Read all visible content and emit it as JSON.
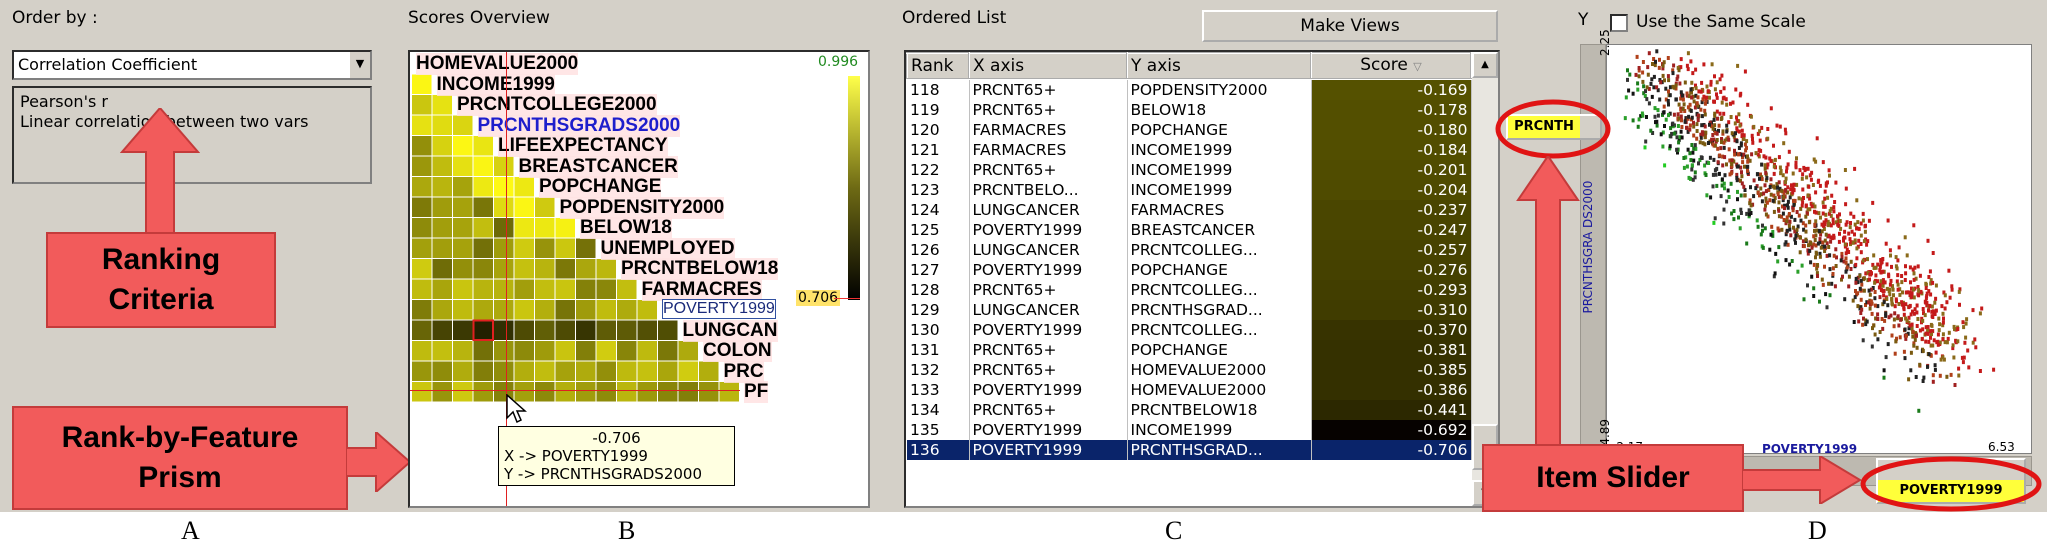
{
  "order_by": {
    "title": "Order by :",
    "criterion": "Correlation Coefficient",
    "description_line1": "Pearson's r",
    "description_line2": "Linear correlation between two vars"
  },
  "scores_overview": {
    "title": "Scores Overview",
    "max_label": "0.996",
    "marker_label": "0.706",
    "variables": [
      "HOMEVALUE2000",
      "INCOME1999",
      "PRCNTCOLLEGE2000",
      "PRCNTHSGRADS2000",
      "LIFEEXPECTANCY",
      "BREASTCANCER",
      "POPCHANGE",
      "POPDENSITY2000",
      "BELOW18",
      "UNEMPLOYED",
      "PRCNTBELOW18",
      "FARMACRES",
      "POVERTY1999",
      "LUNGCAN",
      "COLON",
      "PRC",
      "PF"
    ],
    "highlighted_variable": "PRCNTHSGRADS2000",
    "tooltip": {
      "value": "-0.706",
      "x": "X -> POVERTY1999",
      "y": "Y -> PRCNTHSGRADS2000"
    },
    "color_low": "#000000",
    "color_high": "#ffff4a",
    "highlight_color": "#1e1ecc"
  },
  "ordered_list": {
    "title": "Ordered List",
    "make_views": "Make Views",
    "columns": [
      "Rank",
      "X axis",
      "Y axis",
      "Score"
    ],
    "rows": [
      {
        "rank": "118",
        "x": "PRCNT65+",
        "y": "POPDENSITY2000",
        "score": "-0.169"
      },
      {
        "rank": "119",
        "x": "PRCNT65+",
        "y": "BELOW18",
        "score": "-0.178"
      },
      {
        "rank": "120",
        "x": "FARMACRES",
        "y": "POPCHANGE",
        "score": "-0.180"
      },
      {
        "rank": "121",
        "x": "FARMACRES",
        "y": "INCOME1999",
        "score": "-0.184"
      },
      {
        "rank": "122",
        "x": "PRCNT65+",
        "y": "INCOME1999",
        "score": "-0.201"
      },
      {
        "rank": "123",
        "x": "PRCNTBELO...",
        "y": "INCOME1999",
        "score": "-0.204"
      },
      {
        "rank": "124",
        "x": "LUNGCANCER",
        "y": "FARMACRES",
        "score": "-0.237"
      },
      {
        "rank": "125",
        "x": "POVERTY1999",
        "y": "BREASTCANCER",
        "score": "-0.247"
      },
      {
        "rank": "126",
        "x": "LUNGCANCER",
        "y": "PRCNTCOLLEG...",
        "score": "-0.257"
      },
      {
        "rank": "127",
        "x": "POVERTY1999",
        "y": "POPCHANGE",
        "score": "-0.276"
      },
      {
        "rank": "128",
        "x": "PRCNT65+",
        "y": "PRCNTCOLLEG...",
        "score": "-0.293"
      },
      {
        "rank": "129",
        "x": "LUNGCANCER",
        "y": "PRCNTHSGRAD...",
        "score": "-0.310"
      },
      {
        "rank": "130",
        "x": "POVERTY1999",
        "y": "PRCNTCOLLEG...",
        "score": "-0.370"
      },
      {
        "rank": "131",
        "x": "PRCNT65+",
        "y": "POPCHANGE",
        "score": "-0.381"
      },
      {
        "rank": "132",
        "x": "PRCNT65+",
        "y": "HOMEVALUE2000",
        "score": "-0.385"
      },
      {
        "rank": "133",
        "x": "POVERTY1999",
        "y": "HOMEVALUE2000",
        "score": "-0.386"
      },
      {
        "rank": "134",
        "x": "PRCNT65+",
        "y": "PRCNTBELOW18",
        "score": "-0.441"
      },
      {
        "rank": "135",
        "x": "POVERTY1999",
        "y": "INCOME1999",
        "score": "-0.692"
      },
      {
        "rank": "136",
        "x": "POVERTY1999",
        "y": "PRCNTHSGRAD...",
        "score": "-0.706",
        "selected": true
      }
    ]
  },
  "scatter": {
    "y_letter": "Y",
    "same_scale_label": "Use the Same Scale",
    "same_scale_checked": false,
    "y_axis_label": "PRCNTHSGRA DS2000",
    "x_axis_label": "POVERTY1999",
    "y_max": "2.25",
    "y_min": "-4.89",
    "x_min": "-2.17",
    "x_max": "6.53",
    "y_slider_label": "PRCNTH",
    "x_slider_label": "POVERTY1999"
  },
  "callouts": {
    "ranking_criteria_line1": "Ranking",
    "ranking_criteria_line2": "Criteria",
    "prism_line1": "Rank-by-Feature",
    "prism_line2": "Prism",
    "item_slider": "Item Slider"
  },
  "panel_letters": [
    "A",
    "B",
    "C",
    "D"
  ],
  "colors": {
    "ui_bg": "#d4d0c8",
    "callout_red": "#f25b5b",
    "selection_blue": "#0a246a"
  }
}
